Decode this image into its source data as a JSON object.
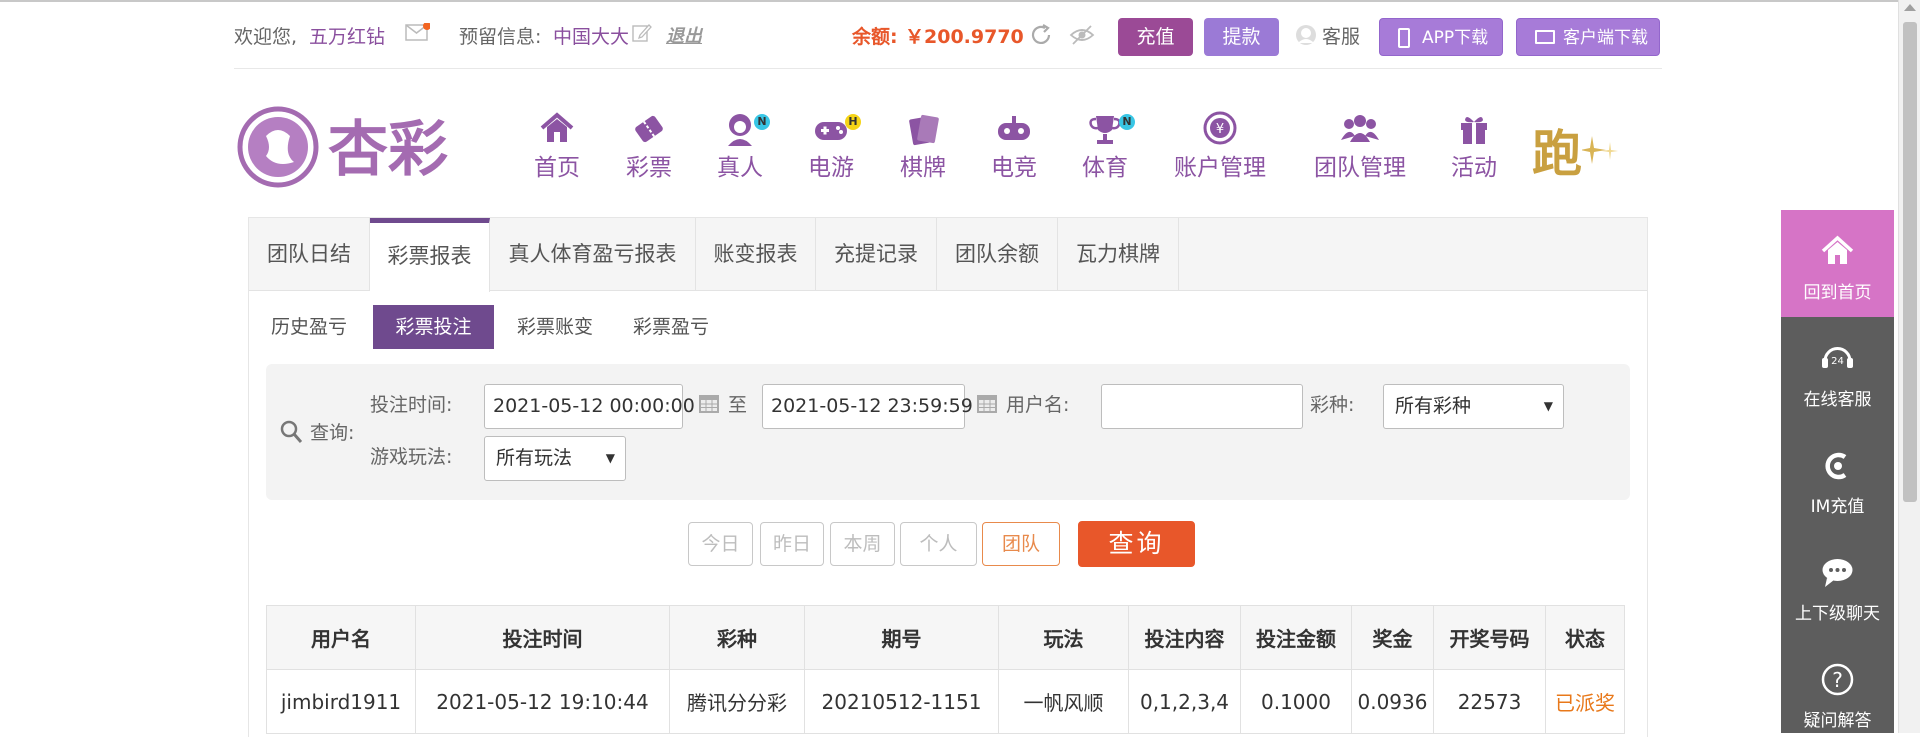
{
  "topbar": {
    "welcome_prefix": "欢迎您,",
    "username": "五万红钻",
    "reserved_label": "预留信息:",
    "reserved_value": "中国大大",
    "logout": "退出",
    "balance_label": "余额:",
    "balance_value": "￥200.9770",
    "recharge": "充值",
    "withdraw": "提款",
    "service": "客服",
    "app_download": "APP下载",
    "client_download": "客户端下载",
    "colors": {
      "balance": "#e8572a",
      "button": "#9b4a96",
      "button2": "#9b7ad6"
    }
  },
  "logo": {
    "text": "杏彩"
  },
  "nav": {
    "items": [
      {
        "label": "首页",
        "icon": "home-icon"
      },
      {
        "label": "彩票",
        "icon": "ticket-icon"
      },
      {
        "label": "真人",
        "icon": "dealer-icon",
        "badge": "N"
      },
      {
        "label": "电游",
        "icon": "gamepad-icon",
        "badge": "H"
      },
      {
        "label": "棋牌",
        "icon": "cards-icon"
      },
      {
        "label": "电竞",
        "icon": "esports-icon"
      },
      {
        "label": "体育",
        "icon": "trophy-icon",
        "badge": "N"
      },
      {
        "label": "账户管理",
        "icon": "yen-icon"
      },
      {
        "label": "团队管理",
        "icon": "team-icon"
      },
      {
        "label": "活动",
        "icon": "gift-icon"
      }
    ],
    "promo_text": "跑"
  },
  "report": {
    "tabs": [
      "团队日结",
      "彩票报表",
      "真人体育盈亏报表",
      "账变报表",
      "充提记录",
      "团队余额",
      "瓦力棋牌"
    ],
    "active_tab": "彩票报表",
    "subtabs": [
      "历史盈亏",
      "彩票投注",
      "彩票账变",
      "彩票盈亏"
    ],
    "active_subtab": "彩票投注"
  },
  "query": {
    "label": "查询:",
    "bet_time_label": "投注时间:",
    "start_time": "2021-05-12 00:00:00",
    "to_label": "至",
    "end_time": "2021-05-12 23:59:59",
    "username_label": "用户名:",
    "username_value": "",
    "lottery_label": "彩种:",
    "lottery_value": "所有彩种",
    "play_label": "游戏玩法:",
    "play_value": "所有玩法",
    "buttons": {
      "today": "今日",
      "yesterday": "昨日",
      "week": "本周",
      "personal": "个人",
      "team": "团队",
      "search": "查询"
    }
  },
  "table": {
    "headers": [
      "用户名",
      "投注时间",
      "彩种",
      "期号",
      "玩法",
      "投注内容",
      "投注金额",
      "奖金",
      "开奖号码",
      "状态"
    ],
    "rows": [
      [
        "jimbird1911",
        "2021-05-12 19:10:44",
        "腾讯分分彩",
        "20210512-1151",
        "一帆风顺",
        "0,1,2,3,4",
        "0.1000",
        "0.0936",
        "22573",
        "已派奖"
      ]
    ]
  },
  "sidebar": {
    "items": [
      {
        "label": "回到首页",
        "icon": "home-icon"
      },
      {
        "label": "在线客服",
        "icon": "support-24-icon"
      },
      {
        "label": "IM充值",
        "icon": "im-recharge-icon"
      },
      {
        "label": "上下级聊天",
        "icon": "chat-icon"
      },
      {
        "label": "疑问解答",
        "icon": "question-icon"
      }
    ]
  }
}
